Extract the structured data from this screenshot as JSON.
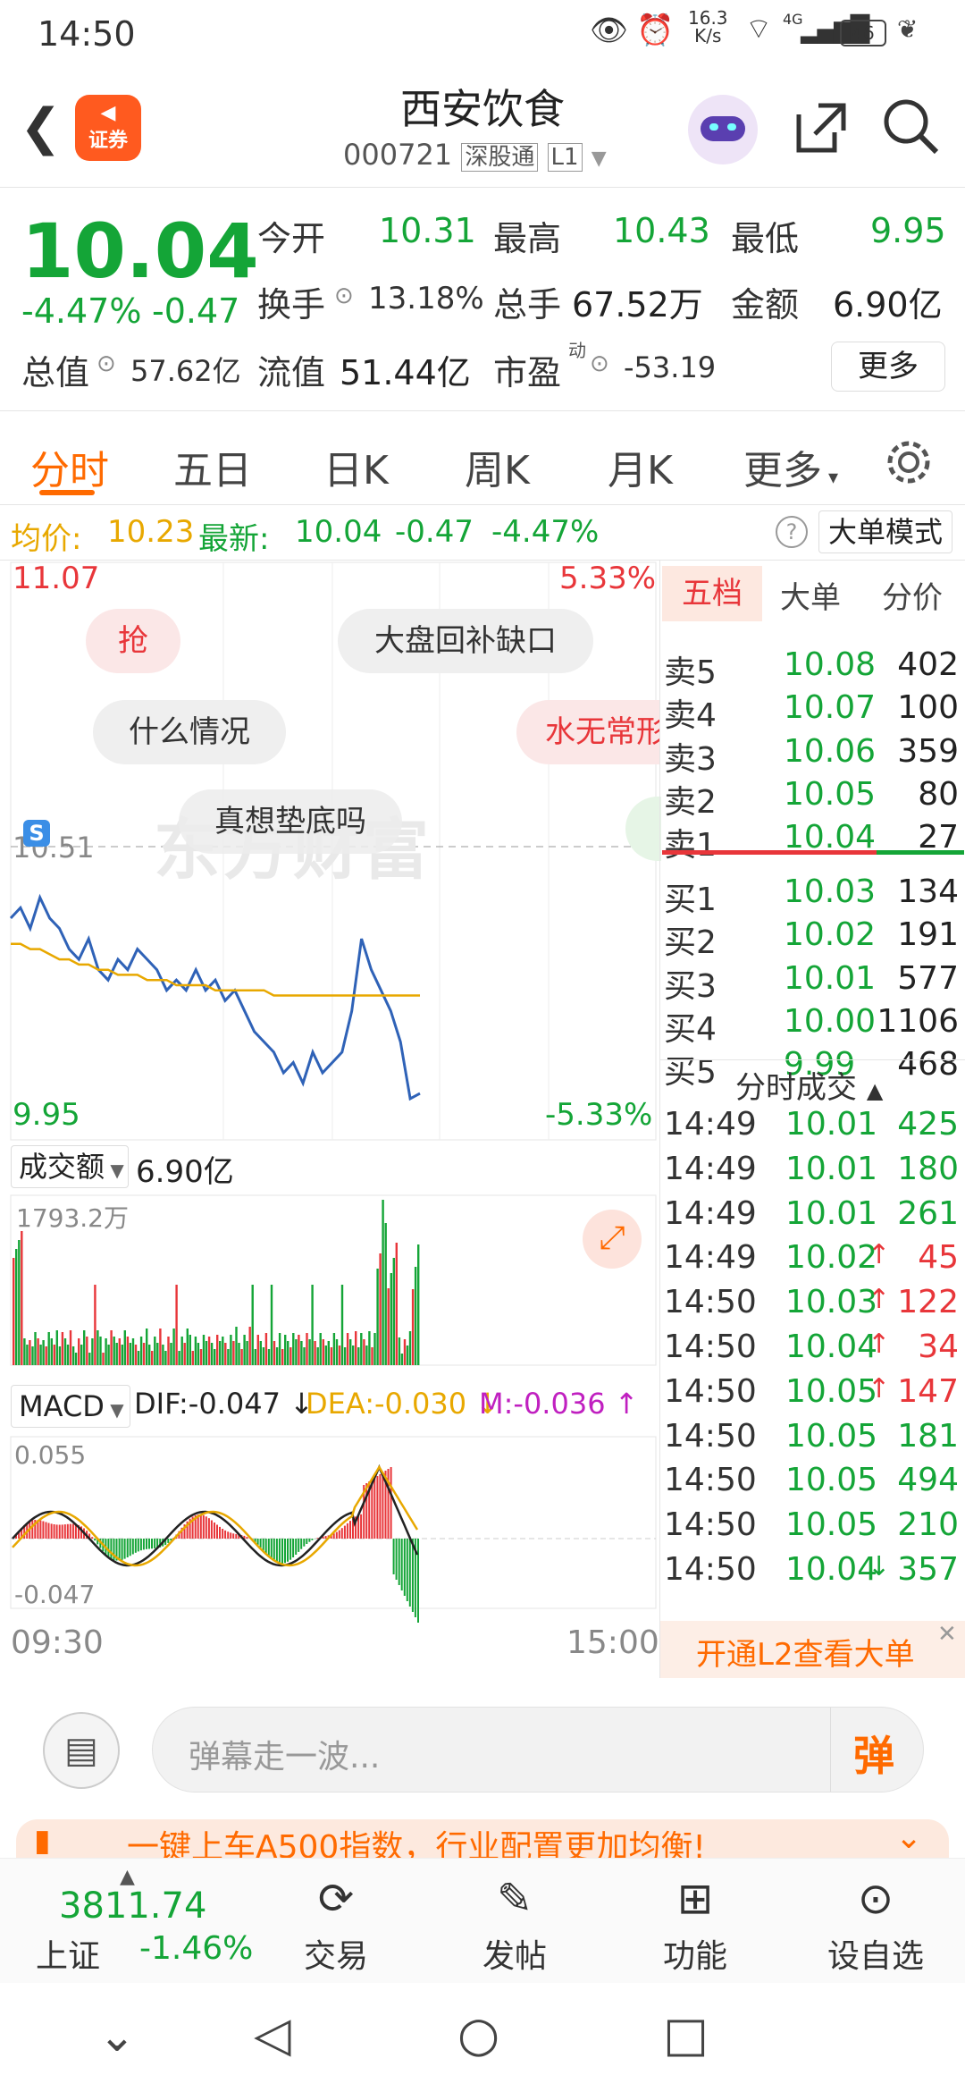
{
  "status": {
    "time": "14:50",
    "net_speed": "16.3",
    "net_unit": "K/s",
    "signal": "4G",
    "battery": "46"
  },
  "header": {
    "badge": "证券",
    "title": "西安饮食",
    "code": "000721",
    "tag1": "深股通",
    "tag2": "L1"
  },
  "quote": {
    "price": "10.04",
    "change_pct": "-4.47%",
    "change": "-0.47",
    "open_label": "今开",
    "open": "10.31",
    "high_label": "最高",
    "high": "10.43",
    "low_label": "最低",
    "low": "9.95",
    "turnover_label": "换手",
    "turnover": "13.18%",
    "volume_label": "总手",
    "volume": "67.52万",
    "amount_label": "金额",
    "amount": "6.90亿",
    "mktcap_label": "总值",
    "mktcap": "57.62亿",
    "float_label": "流值",
    "float": "51.44亿",
    "pe_label": "市盈",
    "pe_sup": "动",
    "pe": "-53.19",
    "more_btn": "更多"
  },
  "tabs": [
    "分时",
    "五日",
    "日K",
    "周K",
    "月K",
    "更多"
  ],
  "avgline": {
    "avg_label": "均价:",
    "avg": "10.23",
    "latest_label": "最新:",
    "latest": "10.04",
    "chg": "-0.47",
    "pct": "-4.47%",
    "bigorder_btn": "大单模式"
  },
  "chart": {
    "top_price": "11.07",
    "top_pct": "5.33%",
    "mid_price": "10.51",
    "bottom_price": "9.95",
    "bottom_pct": "-5.33%",
    "pill_grab": "抢",
    "pill_gap": "大盘回补缺口",
    "pill_what": "什么情况",
    "pill_water": "水无常形",
    "pill_bottom": "真想垫底吗",
    "watermark": "东方财富",
    "s_marker": "S",
    "vol_label": "成交额",
    "vol_value": "6.90亿",
    "vol_max": "1793.2万",
    "macd_label": "MACD",
    "dif": "DIF:-0.047",
    "dea": "DEA:-0.030",
    "m": "M:-0.036",
    "macd_max": "0.055",
    "macd_min": "-0.047",
    "time_start": "09:30",
    "time_end": "15:00"
  },
  "chart_data": {
    "type": "line",
    "title": "",
    "x_range": [
      "09:30",
      "15:00"
    ],
    "ylim": [
      9.95,
      11.07
    ],
    "series": [
      {
        "values": [
          10.38,
          10.4,
          10.36,
          10.42,
          10.38,
          10.36,
          10.32,
          10.3,
          10.34,
          10.28,
          10.26,
          10.3,
          10.28,
          10.32,
          10.3,
          10.28,
          10.24,
          10.26,
          10.24,
          10.28,
          10.24,
          10.26,
          10.22,
          10.24,
          10.2,
          10.16,
          10.14,
          10.12,
          10.08,
          10.1,
          10.06,
          10.12,
          10.08,
          10.1,
          10.12,
          10.2,
          10.34,
          10.28,
          10.24,
          10.2,
          10.14,
          10.03,
          10.04
        ]
      },
      {
        "values": [
          10.33,
          10.33,
          10.32,
          10.32,
          10.31,
          10.3,
          10.3,
          10.29,
          10.29,
          10.28,
          10.28,
          10.27,
          10.27,
          10.27,
          10.26,
          10.26,
          10.26,
          10.25,
          10.25,
          10.25,
          10.25,
          10.24,
          10.24,
          10.24,
          10.24,
          10.24,
          10.24,
          10.23,
          10.23,
          10.23,
          10.23,
          10.23,
          10.23,
          10.23,
          10.23,
          10.23,
          10.23,
          10.23,
          10.23,
          10.23,
          10.23,
          10.23,
          10.23
        ]
      }
    ]
  },
  "orderbook": {
    "tabs": [
      "五档",
      "大单",
      "分价"
    ],
    "asks": [
      {
        "label": "卖5",
        "price": "10.08",
        "vol": "402"
      },
      {
        "label": "卖4",
        "price": "10.07",
        "vol": "100"
      },
      {
        "label": "卖3",
        "price": "10.06",
        "vol": "359"
      },
      {
        "label": "卖2",
        "price": "10.05",
        "vol": "80"
      },
      {
        "label": "卖1",
        "price": "10.04",
        "vol": "27"
      }
    ],
    "bids": [
      {
        "label": "买1",
        "price": "10.03",
        "vol": "134"
      },
      {
        "label": "买2",
        "price": "10.02",
        "vol": "191"
      },
      {
        "label": "买3",
        "price": "10.01",
        "vol": "577"
      },
      {
        "label": "买4",
        "price": "10.00",
        "vol": "1106"
      },
      {
        "label": "买5",
        "price": "9.99",
        "vol": "468"
      }
    ]
  },
  "trades": {
    "title": "分时成交",
    "rows": [
      {
        "t": "14:49",
        "p": "10.01",
        "v": "425",
        "a": ""
      },
      {
        "t": "14:49",
        "p": "10.01",
        "v": "180",
        "a": ""
      },
      {
        "t": "14:49",
        "p": "10.01",
        "v": "261",
        "a": ""
      },
      {
        "t": "14:49",
        "p": "10.02",
        "v": "45",
        "a": "↑"
      },
      {
        "t": "14:50",
        "p": "10.03",
        "v": "122",
        "a": "↑"
      },
      {
        "t": "14:50",
        "p": "10.04",
        "v": "34",
        "a": "↑"
      },
      {
        "t": "14:50",
        "p": "10.05",
        "v": "147",
        "a": "↑"
      },
      {
        "t": "14:50",
        "p": "10.05",
        "v": "181",
        "a": ""
      },
      {
        "t": "14:50",
        "p": "10.05",
        "v": "494",
        "a": ""
      },
      {
        "t": "14:50",
        "p": "10.05",
        "v": "210",
        "a": ""
      },
      {
        "t": "14:50",
        "p": "10.04",
        "v": "357",
        "a": "↓"
      }
    ],
    "l2_banner": "开通L2查看大单"
  },
  "comment": {
    "placeholder": "弹幕走一波...",
    "send": "弹"
  },
  "promo": {
    "text": "一键上车A500指数，行业配置更加均衡!"
  },
  "bottomnav": {
    "index_value": "3811.74",
    "index_name": "上证",
    "index_pct": "-1.46%",
    "trade": "交易",
    "post": "发帖",
    "func": "功能",
    "watch": "设自选"
  },
  "colors": {
    "up": "#e8363a",
    "down": "#14a537",
    "accent": "#ff6a00",
    "avg": "#e8a800"
  }
}
